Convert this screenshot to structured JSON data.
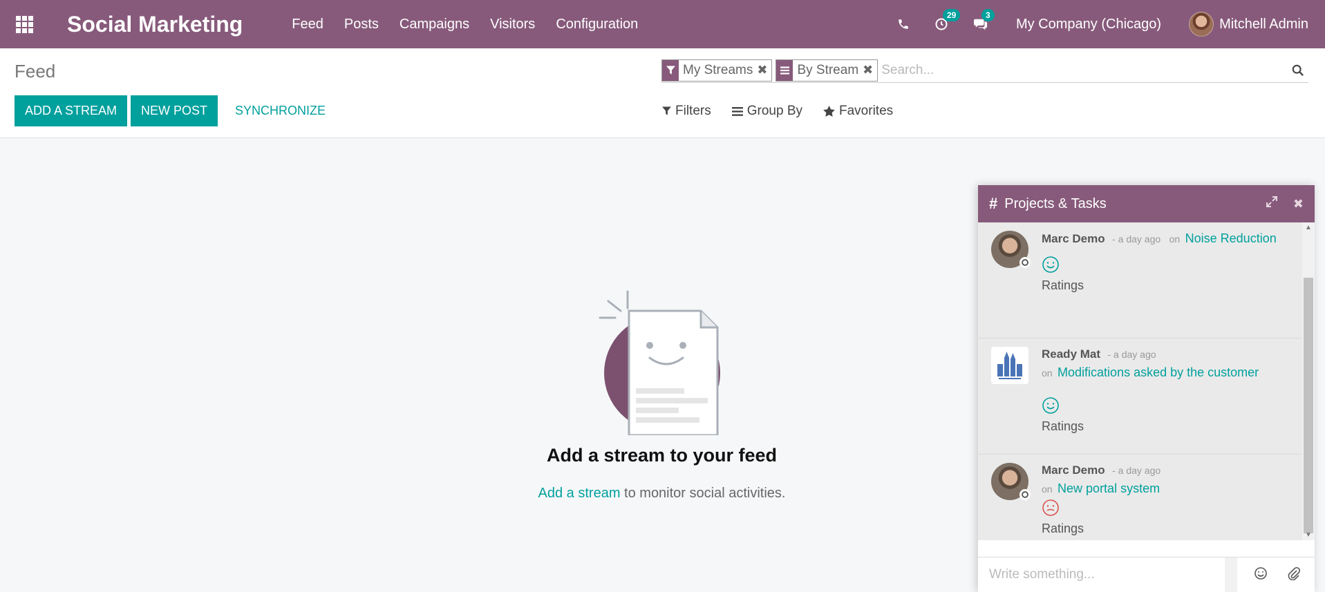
{
  "navbar": {
    "app_title": "Social Marketing",
    "menu": [
      "Feed",
      "Posts",
      "Campaigns",
      "Visitors",
      "Configuration"
    ],
    "activity_count": "29",
    "messages_count": "3",
    "company": "My Company (Chicago)",
    "user": "Mitchell Admin"
  },
  "control_panel": {
    "breadcrumb": "Feed",
    "add_stream_label": "ADD A STREAM",
    "new_post_label": "NEW POST",
    "synchronize_label": "SYNCHRONIZE",
    "facets": [
      "My Streams",
      "By Stream"
    ],
    "search_placeholder": "Search...",
    "filters_label": "Filters",
    "groupby_label": "Group By",
    "favorites_label": "Favorites"
  },
  "empty_state": {
    "title": "Add a stream to your feed",
    "link": "Add a stream",
    "rest": " to monitor social activities."
  },
  "chat": {
    "title": "Projects & Tasks",
    "messages": [
      {
        "author": "Marc Demo",
        "time": "- a day ago",
        "on": "on",
        "link": "Noise Reduction",
        "label": "Ratings",
        "mood": "smile"
      },
      {
        "author": "Ready Mat",
        "time": "- a day ago",
        "on": "on",
        "link": "Modifications asked by the customer",
        "label": "Ratings",
        "mood": "smile"
      },
      {
        "author": "Marc Demo",
        "time": "- a day ago",
        "on": "on",
        "link": "New portal system",
        "label": "Ratings",
        "mood": "neutral"
      }
    ],
    "composer_placeholder": "Write something..."
  },
  "colors": {
    "brand": "#875a7b",
    "accent": "#00a09d",
    "rating_ok": "#00a09d",
    "rating_meh": "#d9534f"
  }
}
